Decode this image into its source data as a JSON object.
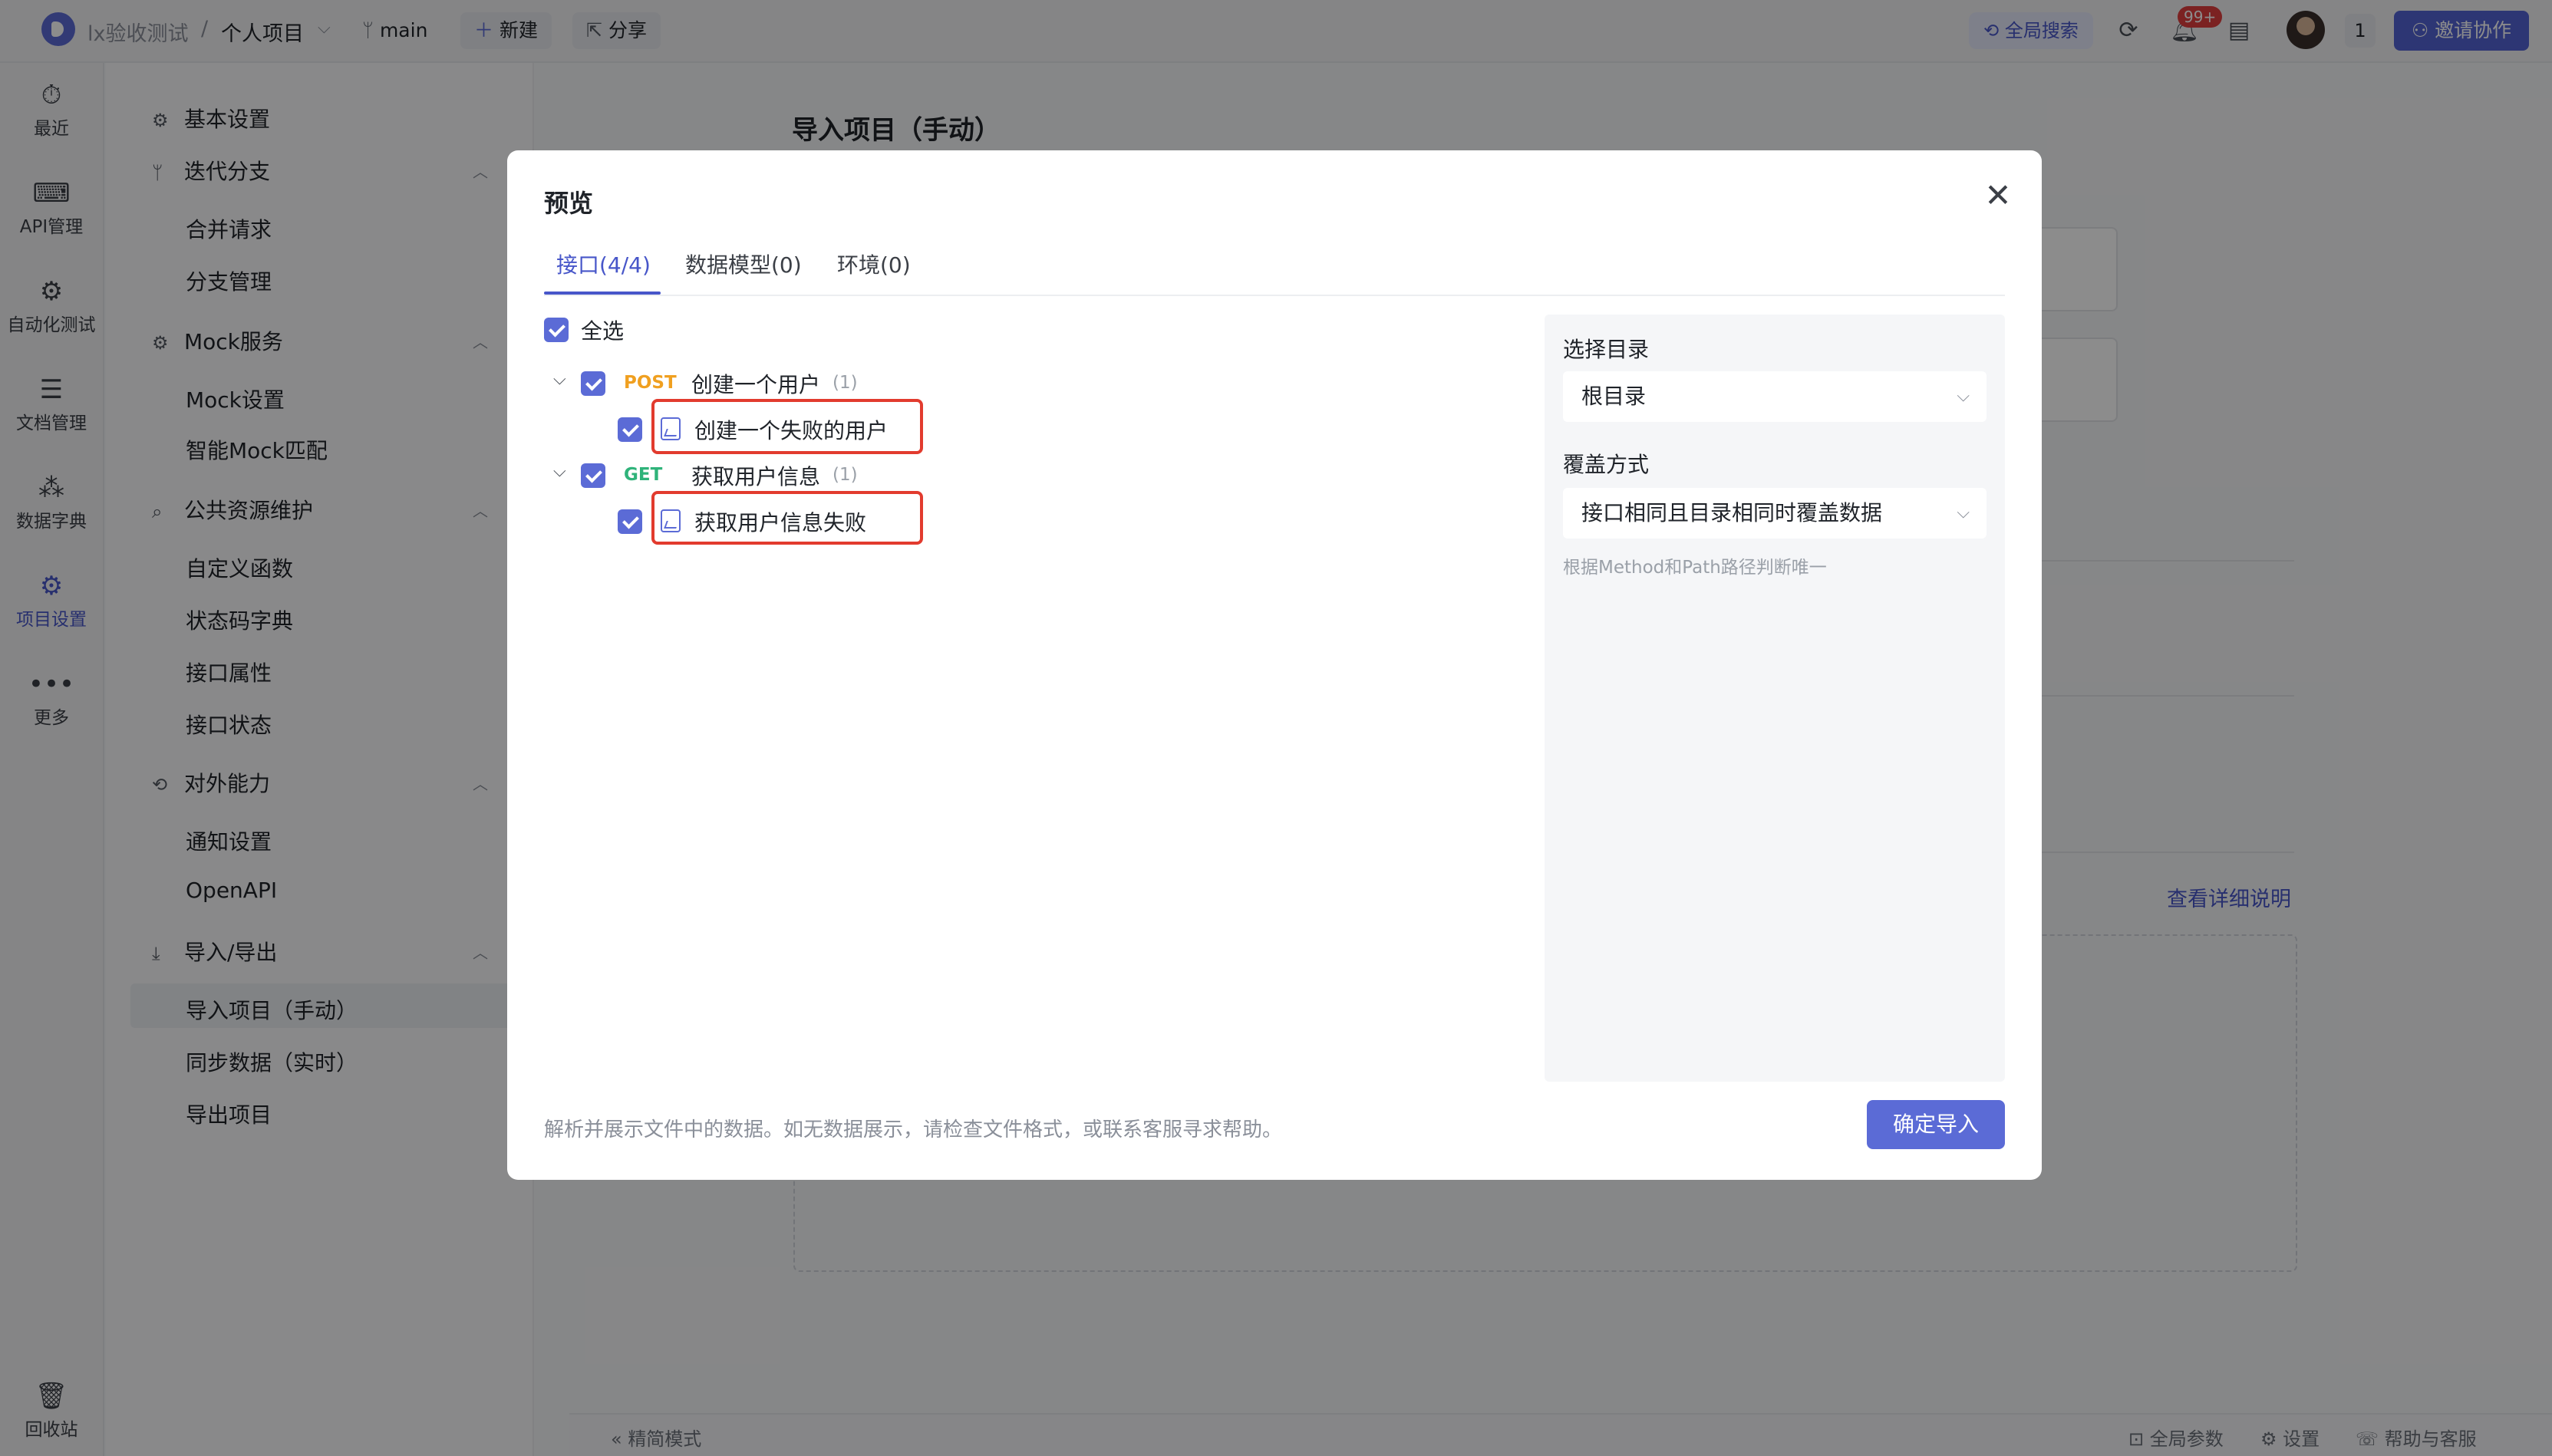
{
  "topbar": {
    "team": "lx验收测试",
    "separator": "/",
    "project": "个人项目",
    "project_caret": "⌵",
    "branch_icon": "branch-icon",
    "branch": "main",
    "new_label": "新建",
    "share_label": "分享",
    "search_label": "全局搜索",
    "notification_badge": "99+",
    "count": "1",
    "invite_label": "邀请协作"
  },
  "rail": {
    "items": [
      {
        "icon": "⏱",
        "label": "最近"
      },
      {
        "icon": "⌨",
        "label": "API管理"
      },
      {
        "icon": "⚙",
        "label": "自动化测试"
      },
      {
        "icon": "☰",
        "label": "文档管理"
      },
      {
        "icon": "⁂",
        "label": "数据字典"
      },
      {
        "icon": "⚙",
        "label": "项目设置"
      },
      {
        "icon": "•••",
        "label": "更多"
      }
    ],
    "trash": {
      "icon": "🗑",
      "label": "回收站"
    }
  },
  "nav": {
    "basic": "基本设置",
    "iter": "迭代分支",
    "iter_items": [
      "合并请求",
      "分支管理"
    ],
    "mock": "Mock服务",
    "mock_items": [
      "Mock设置",
      "智能Mock匹配"
    ],
    "public": "公共资源维护",
    "public_items": [
      "自定义函数",
      "状态码字典",
      "接口属性",
      "接口状态"
    ],
    "external": "对外能力",
    "external_items": [
      "通知设置",
      "OpenAPI"
    ],
    "io": "导入/导出",
    "io_items": [
      "导入项目（手动）",
      "同步数据（实时）",
      "导出项目"
    ]
  },
  "main": {
    "title": "导入项目（手动）",
    "detail_link": "查看详细说明",
    "footer_left": "精简模式",
    "footer_params": "全局参数",
    "footer_settings": "设置",
    "footer_help": "帮助与客服"
  },
  "modal": {
    "title": "预览",
    "close": "✕",
    "tabs": [
      "接口(4/4)",
      "数据模型(0)",
      "环境(0)"
    ],
    "select_all": "全选",
    "groups": [
      {
        "method": "POST",
        "method_color": "#f0a020",
        "name": "创建一个用户",
        "count": "(1)",
        "child": "创建一个失败的用户"
      },
      {
        "method": "GET",
        "method_color": "#2fb37a",
        "name": "获取用户信息",
        "count": "(1)",
        "child": "获取用户信息失败"
      }
    ],
    "side": {
      "dir_label": "选择目录",
      "dir_value": "根目录",
      "cover_label": "覆盖方式",
      "cover_value": "接口相同且目录相同时覆盖数据",
      "hint": "根据Method和Path路径判断唯一"
    },
    "footer_text": "解析并展示文件中的数据。如无数据展示，请检查文件格式，或联系客服寻求帮助。",
    "confirm": "确定导入"
  },
  "colors": {
    "accent": "#5b6bd6",
    "highlight": "#e23b2e"
  }
}
